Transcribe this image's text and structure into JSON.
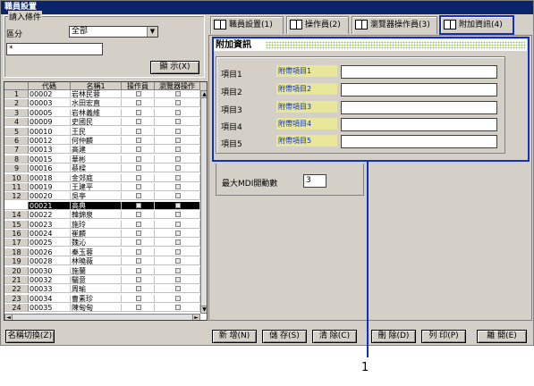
{
  "window": {
    "title": "職員設置"
  },
  "filter": {
    "group_title": "請入條件",
    "region_label": "區分",
    "region_value": "全部",
    "search_value": "*",
    "show_button": "顯 示(X)"
  },
  "grid": {
    "columns": [
      "代碼",
      "名稱1",
      "操作員",
      "瀏覽器操作"
    ],
    "rows": [
      {
        "num": "1",
        "code": "00002",
        "name": "岩林民蓉"
      },
      {
        "num": "2",
        "code": "00003",
        "name": "水田宏直"
      },
      {
        "num": "3",
        "code": "00005",
        "name": "岩林義維"
      },
      {
        "num": "4",
        "code": "00009",
        "name": "史國民"
      },
      {
        "num": "5",
        "code": "00010",
        "name": "王民"
      },
      {
        "num": "6",
        "code": "00012",
        "name": "何仲麟"
      },
      {
        "num": "7",
        "code": "00013",
        "name": "高建"
      },
      {
        "num": "8",
        "code": "00015",
        "name": "華彬"
      },
      {
        "num": "9",
        "code": "00016",
        "name": "蔡樑"
      },
      {
        "num": "10",
        "code": "00018",
        "name": "金郊庭"
      },
      {
        "num": "11",
        "code": "00019",
        "name": "王建平"
      },
      {
        "num": "12",
        "code": "00020",
        "name": "吳亭"
      },
      {
        "num": "",
        "code": "00021",
        "name": "高典",
        "selected": true
      },
      {
        "num": "14",
        "code": "00022",
        "name": "韓錦泉"
      },
      {
        "num": "15",
        "code": "00023",
        "name": "施玲"
      },
      {
        "num": "16",
        "code": "00024",
        "name": "崔麟"
      },
      {
        "num": "17",
        "code": "00025",
        "name": "魏沁"
      },
      {
        "num": "18",
        "code": "00026",
        "name": "秦玉蓉"
      },
      {
        "num": "19",
        "code": "00028",
        "name": "林曉薇"
      },
      {
        "num": "20",
        "code": "00030",
        "name": "施蘭"
      },
      {
        "num": "21",
        "code": "00032",
        "name": "驪意"
      },
      {
        "num": "22",
        "code": "00033",
        "name": "周瑜"
      },
      {
        "num": "23",
        "code": "00034",
        "name": "曹素珍"
      },
      {
        "num": "24",
        "code": "00035",
        "name": "陳甸甸"
      }
    ]
  },
  "tabs": [
    {
      "label": "職員設置(1)"
    },
    {
      "label": "操作員(2)"
    },
    {
      "label": "瀏覽器操作員(3)"
    },
    {
      "label": "附加資訊(4)"
    }
  ],
  "panel": {
    "title": "附加資訊",
    "items": [
      {
        "label": "項目1",
        "field": "附帶項目1"
      },
      {
        "label": "項目2",
        "field": "附帶項目2"
      },
      {
        "label": "項目3",
        "field": "附帶項目3"
      },
      {
        "label": "項目4",
        "field": "附帶項目4"
      },
      {
        "label": "項目5",
        "field": "附帶項目5"
      }
    ],
    "mdi_label": "最大MDI開動數",
    "mdi_value": "3"
  },
  "buttons": {
    "name_switch": "名稱切換(Z)",
    "new": "新 增(N)",
    "save": "儲 存(S)",
    "clear": "清 除(C)",
    "delete": "刪 除(D)",
    "print": "列 印(P)",
    "close": "離 開(E)"
  },
  "callout": {
    "number": "1"
  },
  "colors": {
    "highlight": "#1030c0",
    "titlebar": "#0a246a"
  }
}
